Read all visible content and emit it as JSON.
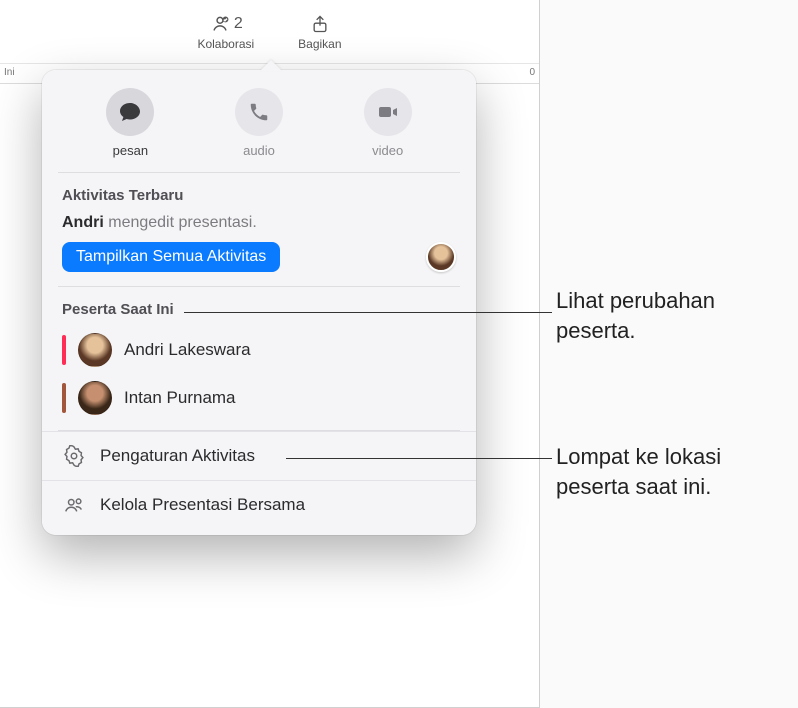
{
  "toolbar": {
    "collaborate_count": "2",
    "collaborate_label": "Kolaborasi",
    "share_label": "Bagikan",
    "ruler_left": "Ini",
    "ruler_right": "0"
  },
  "popover": {
    "comm": {
      "message_label": "pesan",
      "audio_label": "audio",
      "video_label": "video"
    },
    "recent": {
      "title": "Aktivitas Terbaru",
      "actor": "Andri",
      "action": "mengedit presentasi.",
      "show_all": "Tampilkan Semua Aktivitas"
    },
    "participants": {
      "title": "Peserta Saat Ini",
      "items": [
        {
          "name": "Andri Lakeswara",
          "presence_color": "#ff2d55"
        },
        {
          "name": "Intan Purnama",
          "presence_color": "#a04a2d"
        }
      ]
    },
    "footer": {
      "activity_settings": "Pengaturan Aktivitas",
      "manage_shared": "Kelola Presentasi Bersama"
    }
  },
  "callouts": {
    "c1_line1": "Lihat perubahan",
    "c1_line2": "peserta.",
    "c2_line1": "Lompat ke lokasi",
    "c2_line2": "peserta saat ini."
  }
}
